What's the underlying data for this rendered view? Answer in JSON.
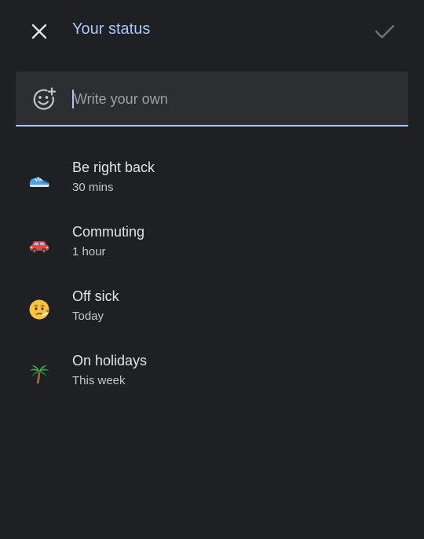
{
  "header": {
    "title": "Your status",
    "close_icon": "close-icon",
    "confirm_icon": "check-icon"
  },
  "input": {
    "placeholder": "Write your own",
    "value": "",
    "icon": "add-emoji-icon"
  },
  "statuses": [
    {
      "icon": "running-shoe-icon",
      "title": "Be right back",
      "duration": "30 mins"
    },
    {
      "icon": "car-icon",
      "title": "Commuting",
      "duration": "1 hour"
    },
    {
      "icon": "sick-face-icon",
      "title": "Off sick",
      "duration": "Today"
    },
    {
      "icon": "palm-tree-icon",
      "title": "On holidays",
      "duration": "This week"
    }
  ],
  "colors": {
    "background": "#1f2023",
    "accent": "#a8c7fa",
    "input_background": "#2d2e31"
  }
}
